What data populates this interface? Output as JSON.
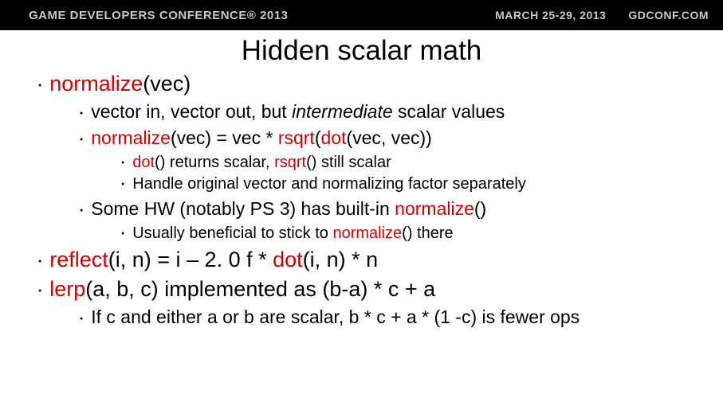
{
  "header": {
    "left": "GAME DEVELOPERS CONFERENCE® 2013",
    "date": "MARCH 25-29, 2013",
    "site": "GDCONF.COM"
  },
  "title": "Hidden scalar math",
  "b1": {
    "p1a": "normalize",
    "p1b": "(vec)"
  },
  "b2": {
    "p1a": "vector in, vector out, but ",
    "p1b": "intermediate",
    "p1c": " scalar values",
    "p2a": "normalize",
    "p2b": "(vec) = vec * ",
    "p2c": "rsqrt",
    "p2d": "(",
    "p2e": "dot",
    "p2f": "(vec, vec))",
    "p3a": "Some HW (notably PS 3) has built-in ",
    "p3b": "normalize",
    "p3c": "()"
  },
  "b3": {
    "p1a": "dot",
    "p1b": "() returns scalar, ",
    "p1c": "rsqrt",
    "p1d": "() still scalar",
    "p2": "Handle original vector and normalizing factor separately",
    "p3a": "Usually beneficial to stick to ",
    "p3b": "normalize",
    "p3c": "() there"
  },
  "b4": {
    "p1a": "reflect",
    "p1b": "(i, n) = i – 2. 0 f * ",
    "p1c": "dot",
    "p1d": "(i, n) * n"
  },
  "b5": {
    "p1a": "lerp",
    "p1b": "(a, b, c) implemented as (b-a) * c + a"
  },
  "b6": {
    "p1": "If c and either a or b are scalar, b * c + a * (1 -c) is fewer ops"
  }
}
